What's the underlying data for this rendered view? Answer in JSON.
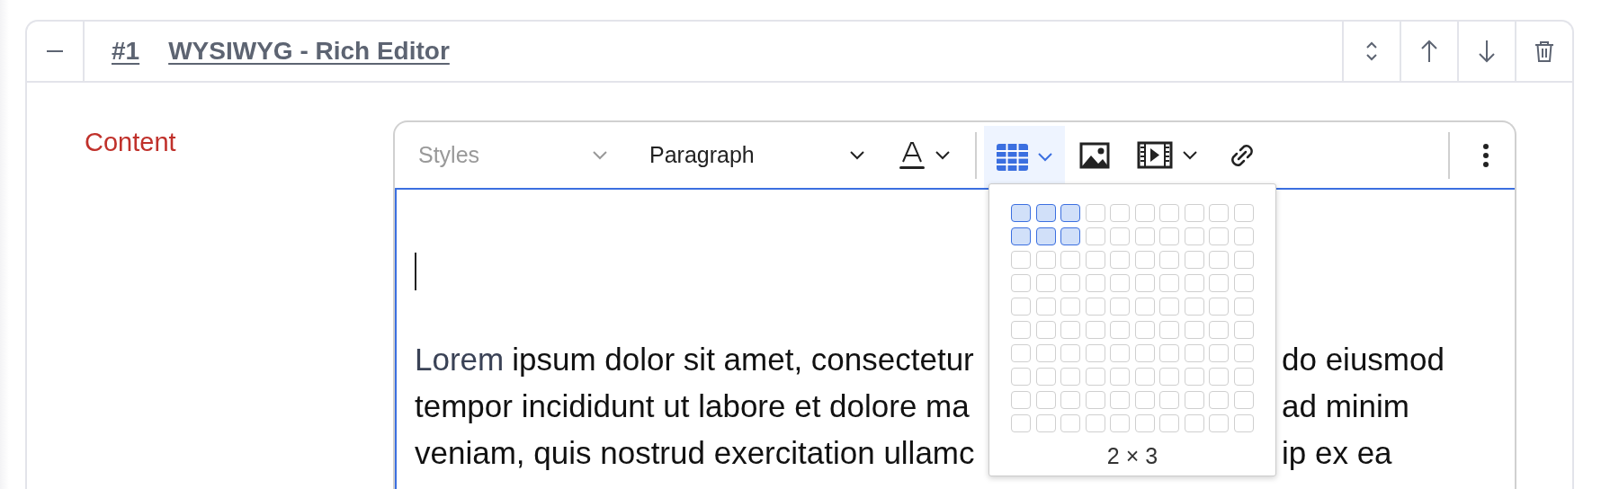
{
  "block": {
    "index": "#1",
    "title": "WYSIWYG - Rich Editor"
  },
  "field": {
    "label": "Content"
  },
  "toolbar": {
    "styles": {
      "placeholder": "Styles"
    },
    "format": {
      "value": "Paragraph"
    },
    "table_button": {
      "selected": true
    }
  },
  "table_picker": {
    "rows": [
      {
        "cells": [
          {
            "selected": true
          },
          {
            "selected": true
          },
          {
            "selected": true
          },
          {
            "selected": false
          },
          {
            "selected": false
          },
          {
            "selected": false
          },
          {
            "selected": false
          },
          {
            "selected": false
          },
          {
            "selected": false
          },
          {
            "selected": false
          }
        ]
      },
      {
        "cells": [
          {
            "selected": true
          },
          {
            "selected": true
          },
          {
            "selected": true
          },
          {
            "selected": false
          },
          {
            "selected": false
          },
          {
            "selected": false
          },
          {
            "selected": false
          },
          {
            "selected": false
          },
          {
            "selected": false
          },
          {
            "selected": false
          }
        ]
      },
      {
        "cells": [
          {
            "selected": false
          },
          {
            "selected": false
          },
          {
            "selected": false
          },
          {
            "selected": false
          },
          {
            "selected": false
          },
          {
            "selected": false
          },
          {
            "selected": false
          },
          {
            "selected": false
          },
          {
            "selected": false
          },
          {
            "selected": false
          }
        ]
      },
      {
        "cells": [
          {
            "selected": false
          },
          {
            "selected": false
          },
          {
            "selected": false
          },
          {
            "selected": false
          },
          {
            "selected": false
          },
          {
            "selected": false
          },
          {
            "selected": false
          },
          {
            "selected": false
          },
          {
            "selected": false
          },
          {
            "selected": false
          }
        ]
      },
      {
        "cells": [
          {
            "selected": false
          },
          {
            "selected": false
          },
          {
            "selected": false
          },
          {
            "selected": false
          },
          {
            "selected": false
          },
          {
            "selected": false
          },
          {
            "selected": false
          },
          {
            "selected": false
          },
          {
            "selected": false
          },
          {
            "selected": false
          }
        ]
      },
      {
        "cells": [
          {
            "selected": false
          },
          {
            "selected": false
          },
          {
            "selected": false
          },
          {
            "selected": false
          },
          {
            "selected": false
          },
          {
            "selected": false
          },
          {
            "selected": false
          },
          {
            "selected": false
          },
          {
            "selected": false
          },
          {
            "selected": false
          }
        ]
      },
      {
        "cells": [
          {
            "selected": false
          },
          {
            "selected": false
          },
          {
            "selected": false
          },
          {
            "selected": false
          },
          {
            "selected": false
          },
          {
            "selected": false
          },
          {
            "selected": false
          },
          {
            "selected": false
          },
          {
            "selected": false
          },
          {
            "selected": false
          }
        ]
      },
      {
        "cells": [
          {
            "selected": false
          },
          {
            "selected": false
          },
          {
            "selected": false
          },
          {
            "selected": false
          },
          {
            "selected": false
          },
          {
            "selected": false
          },
          {
            "selected": false
          },
          {
            "selected": false
          },
          {
            "selected": false
          },
          {
            "selected": false
          }
        ]
      },
      {
        "cells": [
          {
            "selected": false
          },
          {
            "selected": false
          },
          {
            "selected": false
          },
          {
            "selected": false
          },
          {
            "selected": false
          },
          {
            "selected": false
          },
          {
            "selected": false
          },
          {
            "selected": false
          },
          {
            "selected": false
          },
          {
            "selected": false
          }
        ]
      },
      {
        "cells": [
          {
            "selected": false
          },
          {
            "selected": false
          },
          {
            "selected": false
          },
          {
            "selected": false
          },
          {
            "selected": false
          },
          {
            "selected": false
          },
          {
            "selected": false
          },
          {
            "selected": false
          },
          {
            "selected": false
          },
          {
            "selected": false
          }
        ]
      }
    ],
    "size_label": "2 × 3"
  },
  "content_lines": [
    {
      "marked": "Lorem",
      "left": "ipsum dolor sit amet, consectetur",
      "right": "do eiusmod"
    },
    {
      "left": "tempor incididunt ut labore et dolore ma",
      "right": "ad minim"
    },
    {
      "left": "veniam, quis nostrud exercitation ullamc",
      "right": "ip ex ea"
    }
  ]
}
